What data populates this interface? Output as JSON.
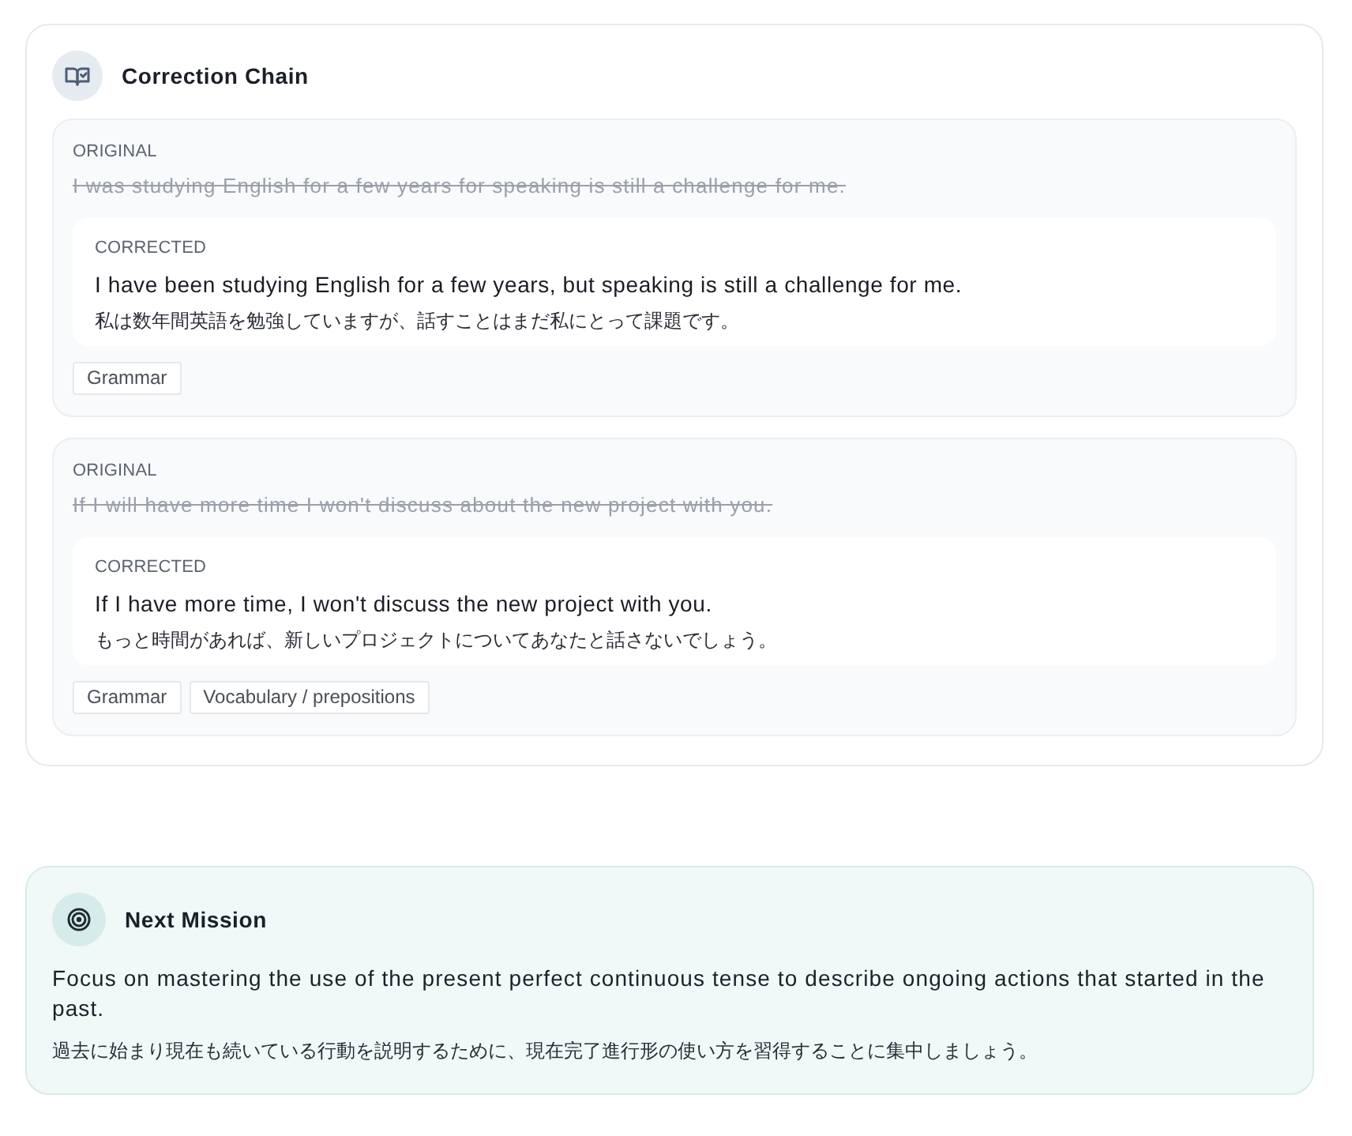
{
  "correction_chain": {
    "title": "Correction Chain",
    "items": [
      {
        "original_label": "ORIGINAL",
        "original": "I was studying English for a few years for speaking is still a challenge for me.",
        "corrected_label": "CORRECTED",
        "corrected": "I have been studying English for a few years, but speaking is still a challenge for me.",
        "translation": "私は数年間英語を勉強していますが、話すことはまだ私にとって課題です。",
        "tags": [
          "Grammar"
        ]
      },
      {
        "original_label": "ORIGINAL",
        "original": "If I will have more time I won't discuss about the new project with you.",
        "corrected_label": "CORRECTED",
        "corrected": "If I have more time, I won't discuss the new project with you.",
        "translation": "もっと時間があれば、新しいプロジェクトについてあなたと話さないでしょう。",
        "tags": [
          "Grammar",
          "Vocabulary / prepositions"
        ]
      }
    ]
  },
  "next_mission": {
    "title": "Next Mission",
    "text": "Focus on mastering the use of the present perfect continuous tense to describe ongoing actions that started in the past.",
    "translation": "過去に始まり現在も続いている行動を説明するために、現在完了進行形の使い方を習得することに集中しましょう。"
  }
}
